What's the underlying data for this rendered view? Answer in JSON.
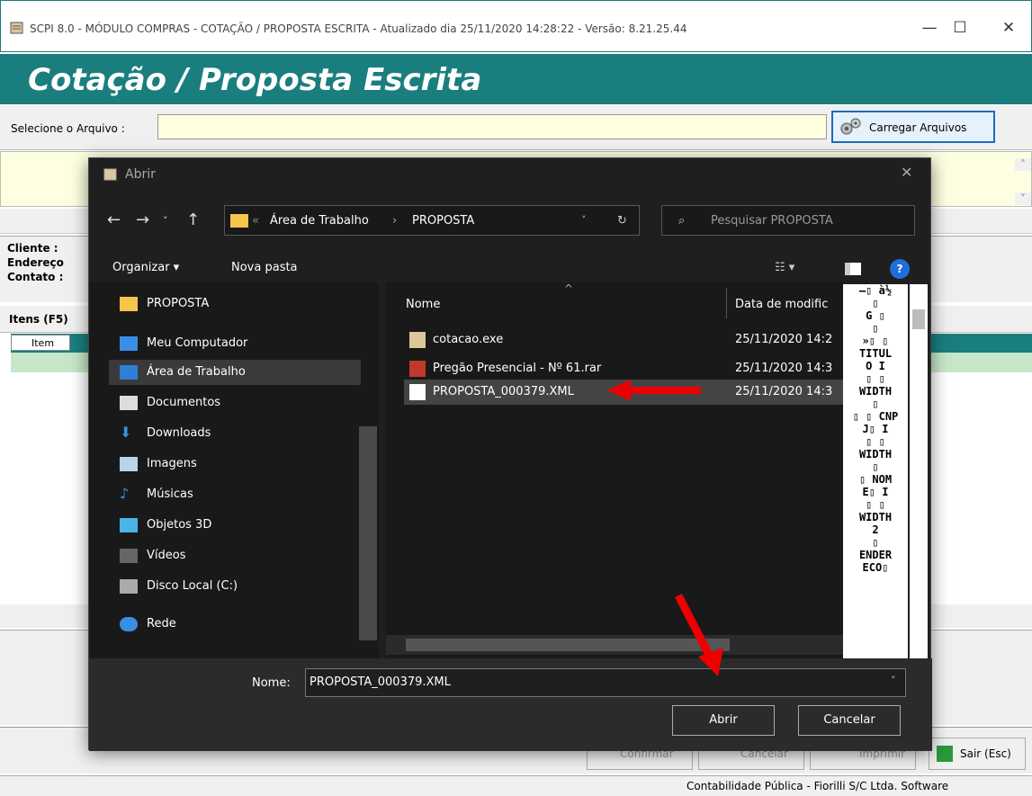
{
  "window": {
    "title": "SCPI 8.0 - MÓDULO COMPRAS - COTAÇÃO / PROPOSTA ESCRITA - Atualizado dia 25/11/2020 14:28:22 - Versão: 8.21.25.44",
    "minimize": "—",
    "maximize": "☐",
    "close": "✕"
  },
  "header": {
    "banner": "Cotação / Proposta Escrita"
  },
  "select": {
    "label": "Selecione o Arquivo :",
    "value": "",
    "button": "Carregar Arquivos"
  },
  "client": {
    "cliente": "Cliente :",
    "endereco": "Endereço",
    "contato": "Contato :"
  },
  "items": {
    "tab": "Itens (F5)",
    "col_item": "Item"
  },
  "footer": {
    "confirmar": "Confirmar",
    "cancelar": "Cancelar",
    "imprimir": "Imprimir",
    "sair": "Sair (Esc)"
  },
  "status": {
    "text": "Contabilidade Pública - Fiorilli S/C Ltda. Software"
  },
  "dialog": {
    "title": "Abrir",
    "close": "✕",
    "address": {
      "crumb1": "Área de Trabalho",
      "sep": "›",
      "crumb2": "PROPOSTA",
      "chev": "«"
    },
    "search_placeholder": "Pesquisar PROPOSTA",
    "toolbar": {
      "organize": "Organizar ▾",
      "new_folder": "Nova pasta"
    },
    "nav": [
      "PROPOSTA",
      "Meu Computador",
      "Área de Trabalho",
      "Documentos",
      "Downloads",
      "Imagens",
      "Músicas",
      "Objetos 3D",
      "Vídeos",
      "Disco Local (C:)",
      "Rede"
    ],
    "columns": {
      "name": "Nome",
      "date": "Data de modific"
    },
    "files": [
      {
        "name": "cotacao.exe",
        "date": "25/11/2020 14:2"
      },
      {
        "name": "Pregão Presencial - Nº 61.rar",
        "date": "25/11/2020 14:3"
      },
      {
        "name": "PROPOSTA_000379.XML",
        "date": "25/11/2020 14:3"
      }
    ],
    "preview": [
      "–▯ à½",
      "▯",
      "G ▯",
      "▯",
      "»▯ ▯",
      "TITUL",
      "O  I",
      "▯  ▯",
      "WIDTH",
      "▯",
      "▯ ▯ CNP",
      "J▯  I",
      "▯  ▯",
      "WIDTH",
      "▯",
      "▯ NOM",
      "E▯  I",
      "▯  ▯",
      "WIDTH",
      "2",
      "▯",
      "ENDER",
      "ECO▯"
    ],
    "filename_label": "Nome:",
    "filename": "PROPOSTA_000379.XML",
    "open": "Abrir",
    "cancel": "Cancelar"
  },
  "colors": {
    "teal": "#1b7e7e",
    "dialog_bg": "#1f1f1f",
    "arrow": "#e00000"
  }
}
